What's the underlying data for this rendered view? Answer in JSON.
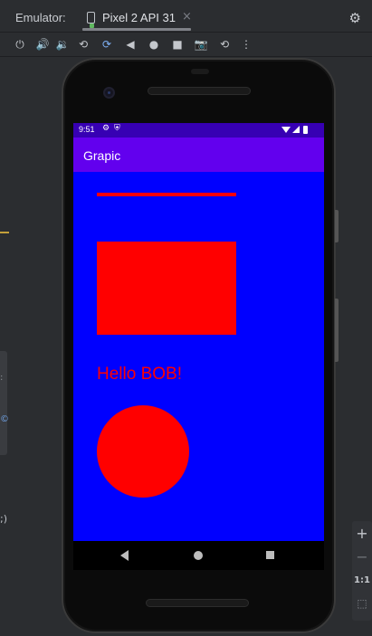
{
  "window": {
    "panel_label": "Emulator:",
    "tab_label": "Pixel 2 API 31",
    "tab_close": "×",
    "settings_icon": "gear-icon"
  },
  "toolbar": {
    "icons": [
      "power-icon",
      "volume-up-icon",
      "volume-down-icon",
      "rotate-left-icon",
      "rotate-right-icon",
      "back-icon",
      "home-icon",
      "overview-icon",
      "screenshot-icon",
      "snapshot-icon",
      "more-icon"
    ],
    "glyphs": [
      "⏻",
      "🔊",
      "🔉",
      "⟲",
      "⟳",
      "◀",
      "●",
      "■",
      "📷",
      "⟲",
      "⋮"
    ]
  },
  "zoom": {
    "plus": "+",
    "minus": "−",
    "ratio": "1:1",
    "fit": "⬚"
  },
  "device": {
    "status_bar": {
      "time": "9:51",
      "gear": "⚙",
      "shield": "⛨"
    },
    "app": {
      "title": "Grapic",
      "greeting": "Hello BOB!"
    },
    "colors": {
      "screen_background": "#0000ff",
      "shapes": "#ff0000",
      "app_bar": "#6200ee",
      "status_bar": "#3700b3"
    }
  }
}
